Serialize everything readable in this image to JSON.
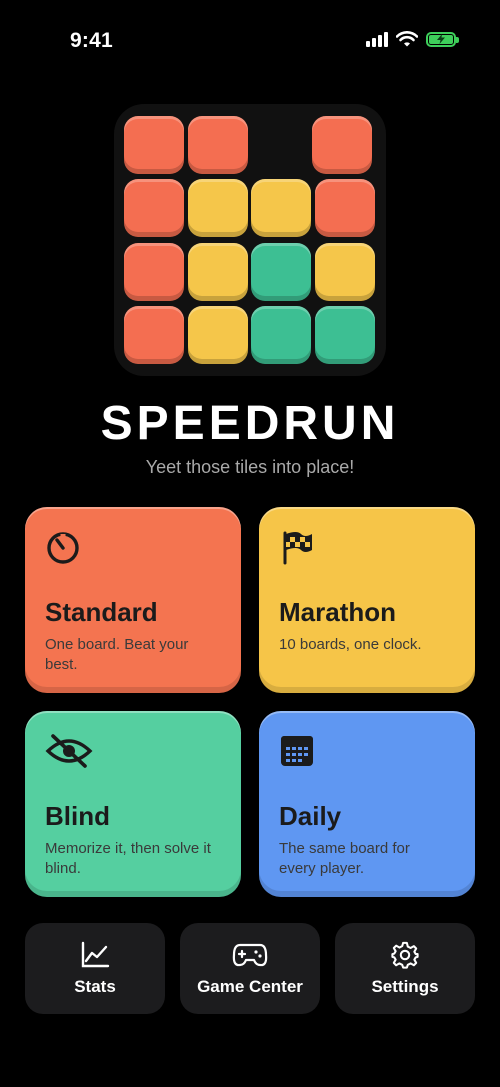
{
  "status": {
    "time": "9:41"
  },
  "app": {
    "title": "SPEEDRUN",
    "subtitle": "Yeet those tiles into place!"
  },
  "modes": [
    {
      "name": "Standard",
      "desc": "One board. Beat your best.",
      "icon": "timer-icon",
      "color": "#f47450"
    },
    {
      "name": "Marathon",
      "desc": "10 boards, one clock.",
      "icon": "checkered-flag-icon",
      "color": "#f6c548"
    },
    {
      "name": "Blind",
      "desc": "Memorize it, then solve it blind.",
      "icon": "eye-slash-icon",
      "color": "#55cfa0"
    },
    {
      "name": "Daily",
      "desc": "The same board for every player.",
      "icon": "calendar-icon",
      "color": "#5f97f2"
    }
  ],
  "bottom": {
    "stats": "Stats",
    "game_center": "Game Center",
    "settings": "Settings"
  },
  "colors": {
    "red": "#f46e51",
    "yellow": "#f5c64a",
    "green": "#3dbf93",
    "background": "#000000"
  }
}
